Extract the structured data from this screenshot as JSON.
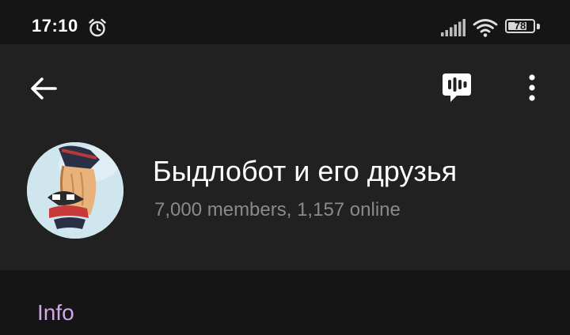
{
  "status_bar": {
    "time": "17:10",
    "battery": "78",
    "battery_level": 0.78
  },
  "header": {
    "back_icon": "arrow-left-icon",
    "voice_chat_icon": "voice-chat-icon",
    "more_icon": "more-vertical-icon"
  },
  "chat": {
    "title": "Быдлобот и его друзья",
    "subtitle": "7,000 members, 1,157 online"
  },
  "section": {
    "info_label": "Info"
  },
  "colors": {
    "background": "#151515",
    "header": "#212121",
    "accent": "#d4a6e6",
    "subtitle": "#8a8a8a"
  }
}
